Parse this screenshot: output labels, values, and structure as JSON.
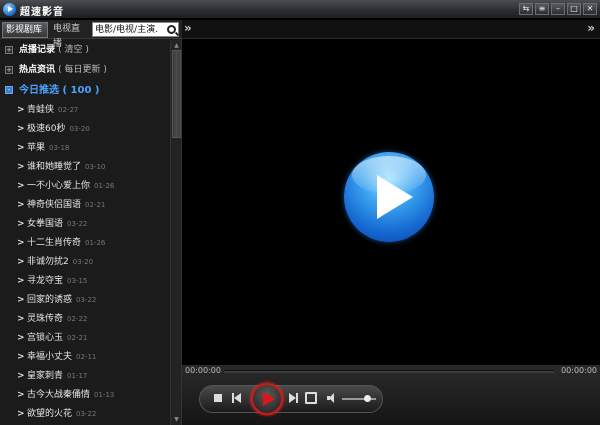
{
  "window": {
    "title": "超速影音",
    "controls": [
      "⇆",
      "≡",
      "–",
      "□",
      "✕"
    ]
  },
  "sidebar": {
    "tabs": [
      {
        "label": "影视剧库"
      },
      {
        "label": "电视直播"
      }
    ],
    "search": {
      "placeholder": "电影/电视/主演...",
      "value": "电影/电视/主演."
    },
    "categories": [
      {
        "label": "点播记录",
        "extra": "( 清空 )",
        "toggle": "+"
      },
      {
        "label": "热点资讯",
        "extra": "( 每日更新 )",
        "toggle": "+"
      },
      {
        "label": "今日推选",
        "extra": "( 100 )",
        "toggle": "-"
      }
    ],
    "items": [
      {
        "title": "青蛙侠",
        "date": "02-27"
      },
      {
        "title": "极速60秒",
        "date": "03-20"
      },
      {
        "title": "苹果",
        "date": "03-18"
      },
      {
        "title": "谁和她睡觉了",
        "date": "03-10"
      },
      {
        "title": "一不小心爱上你",
        "date": "01-26"
      },
      {
        "title": "神奇侠侣国语",
        "date": "02-21"
      },
      {
        "title": "女拳国语",
        "date": "03-22"
      },
      {
        "title": "十二生肖传奇",
        "date": "01-26"
      },
      {
        "title": "非诚勿扰2",
        "date": "03-20"
      },
      {
        "title": "寻龙夺宝",
        "date": "03-15"
      },
      {
        "title": "回家的诱惑",
        "date": "03-22"
      },
      {
        "title": "灵珠传奇",
        "date": "02-22"
      },
      {
        "title": "宫锁心玉",
        "date": "02-21"
      },
      {
        "title": "幸福小丈夫",
        "date": "02-11"
      },
      {
        "title": "皇家刺青",
        "date": "01-17"
      },
      {
        "title": "古今大战秦俑情",
        "date": "01-13"
      },
      {
        "title": "欲望的火花",
        "date": "03-22"
      }
    ]
  },
  "main": {
    "expand_left": "»",
    "expand_right": "»"
  },
  "player": {
    "time_current": "00:00:00",
    "time_total": "00:00:00",
    "progress": 0,
    "volume": 0.7
  },
  "colors": {
    "accent_blue": "#4aa3ff",
    "play_red": "#d01818"
  }
}
